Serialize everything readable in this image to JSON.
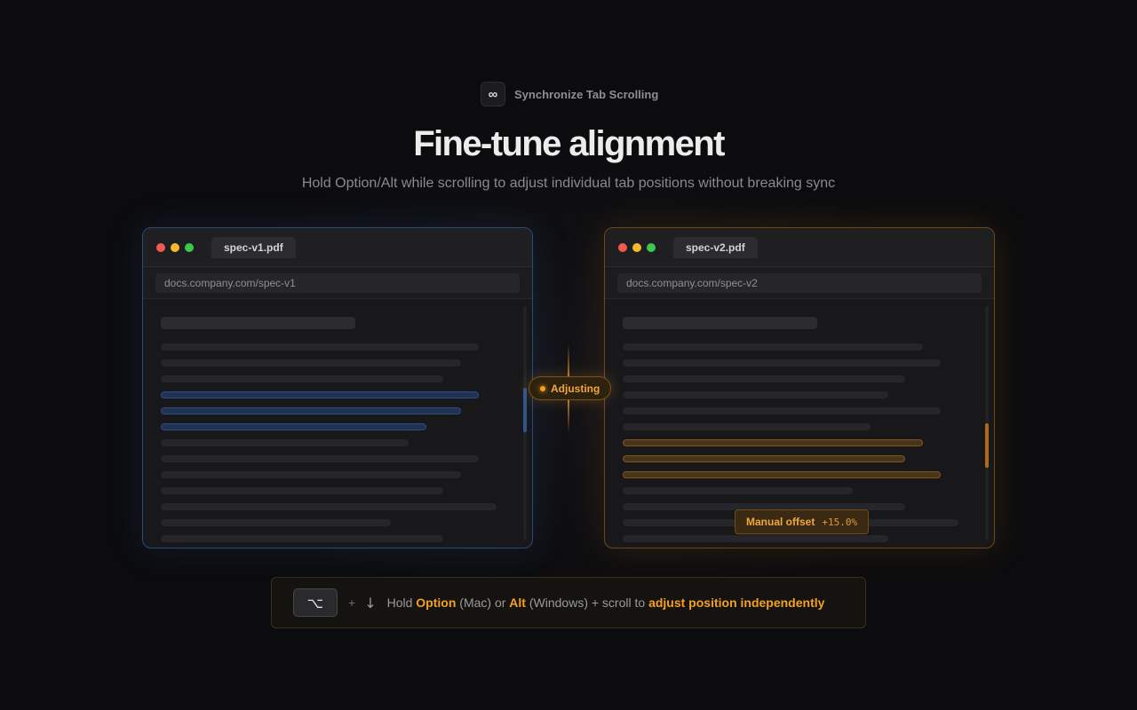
{
  "header": {
    "app_icon": "∞",
    "app_name": "Synchronize Tab Scrolling",
    "title": "Fine-tune alignment",
    "subtitle": "Hold Option/Alt while scrolling to adjust individual tab positions without breaking sync"
  },
  "left_window": {
    "tab_label": "spec-v1.pdf",
    "url": "docs.company.com/spec-v1",
    "accent": "#2b4a78"
  },
  "right_window": {
    "tab_label": "spec-v2.pdf",
    "url": "docs.company.com/spec-v2",
    "accent": "#6a4a1a",
    "offset_label": "Manual offset",
    "offset_value": "+15.0%"
  },
  "status": {
    "label": "Adjusting",
    "color": "#f5a020"
  },
  "hint": {
    "key_icon": "⌥",
    "plus": "+",
    "arrow_icon": "↓",
    "part1": "Hold",
    "option": "Option",
    "part2": "(Mac) or",
    "alt": "Alt",
    "part3": "(Windows) + scroll to",
    "action": "adjust position independently"
  }
}
